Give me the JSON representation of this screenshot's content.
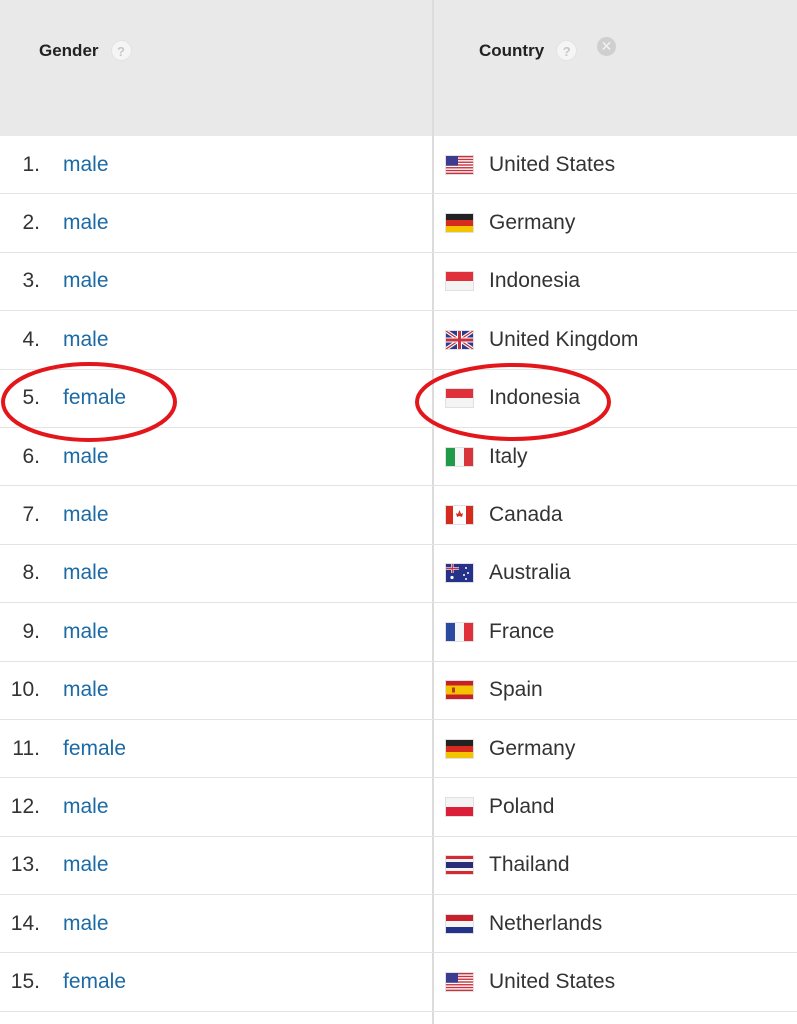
{
  "header": {
    "gender_label": "Gender",
    "country_label": "Country",
    "help_glyph": "?",
    "remove_glyph": "✕"
  },
  "rows": [
    {
      "index": "1.",
      "gender": "male",
      "country": "United States",
      "flag": "us"
    },
    {
      "index": "2.",
      "gender": "male",
      "country": "Germany",
      "flag": "de"
    },
    {
      "index": "3.",
      "gender": "male",
      "country": "Indonesia",
      "flag": "id"
    },
    {
      "index": "4.",
      "gender": "male",
      "country": "United Kingdom",
      "flag": "gb"
    },
    {
      "index": "5.",
      "gender": "female",
      "country": "Indonesia",
      "flag": "id"
    },
    {
      "index": "6.",
      "gender": "male",
      "country": "Italy",
      "flag": "it"
    },
    {
      "index": "7.",
      "gender": "male",
      "country": "Canada",
      "flag": "ca"
    },
    {
      "index": "8.",
      "gender": "male",
      "country": "Australia",
      "flag": "au"
    },
    {
      "index": "9.",
      "gender": "male",
      "country": "France",
      "flag": "fr"
    },
    {
      "index": "10.",
      "gender": "male",
      "country": "Spain",
      "flag": "es"
    },
    {
      "index": "11.",
      "gender": "female",
      "country": "Germany",
      "flag": "de"
    },
    {
      "index": "12.",
      "gender": "male",
      "country": "Poland",
      "flag": "pl"
    },
    {
      "index": "13.",
      "gender": "male",
      "country": "Thailand",
      "flag": "th"
    },
    {
      "index": "14.",
      "gender": "male",
      "country": "Netherlands",
      "flag": "nl"
    },
    {
      "index": "15.",
      "gender": "female",
      "country": "United States",
      "flag": "us"
    }
  ],
  "highlight": {
    "color": "#e3161b",
    "row_index": 5
  },
  "colors": {
    "link": "#1b6aa5",
    "header_bg": "#e9e9e9"
  }
}
